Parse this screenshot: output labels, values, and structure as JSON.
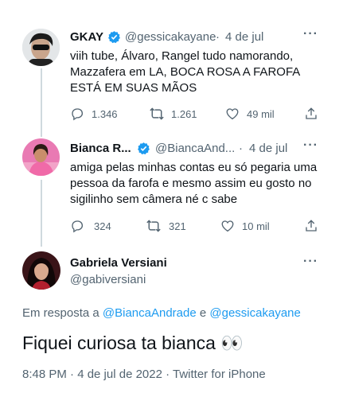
{
  "tweets": [
    {
      "name": "GKAY",
      "handle": "@gessicakayane",
      "dot": "·",
      "date": "4 de jul",
      "lines": [
        "viih tube, Álvaro, Rangel tudo namorando,",
        "Mazzafera em LA, BOCA ROSA A FAROFA",
        "ESTÁ EM SUAS MÃOS"
      ],
      "replies": "1.346",
      "retweets": "1.261",
      "likes": "49 mil"
    },
    {
      "name": "Bianca R...",
      "handle": "@BiancaAnd...",
      "dot": "·",
      "date": "4 de jul",
      "lines": [
        "amiga pelas minhas contas eu só pegaria uma",
        "pessoa da farofa e mesmo assim eu gosto no",
        "sigilinho sem câmera né c sabe"
      ],
      "replies": "324",
      "retweets": "321",
      "likes": "10 mil"
    }
  ],
  "main": {
    "name": "Gabriela Versiani",
    "handle": "@gabiversiani",
    "reply_prefix": "Em resposta a",
    "reply_user1": "@BiancaAndrade",
    "reply_and": "e",
    "reply_user2": "@gessicakayane",
    "text": "Fiquei curiosa ta bianca 👀",
    "timestamp": "8:48 PM · 4 de jul de 2022 · Twitter for iPhone"
  },
  "colors": {
    "accent": "#1d9bf0",
    "muted": "#536471",
    "text": "#0f1419",
    "line": "#cfd9de"
  },
  "icons": [
    "reply-icon",
    "retweet-icon",
    "like-icon",
    "share-icon",
    "more-icon",
    "verified-icon"
  ]
}
